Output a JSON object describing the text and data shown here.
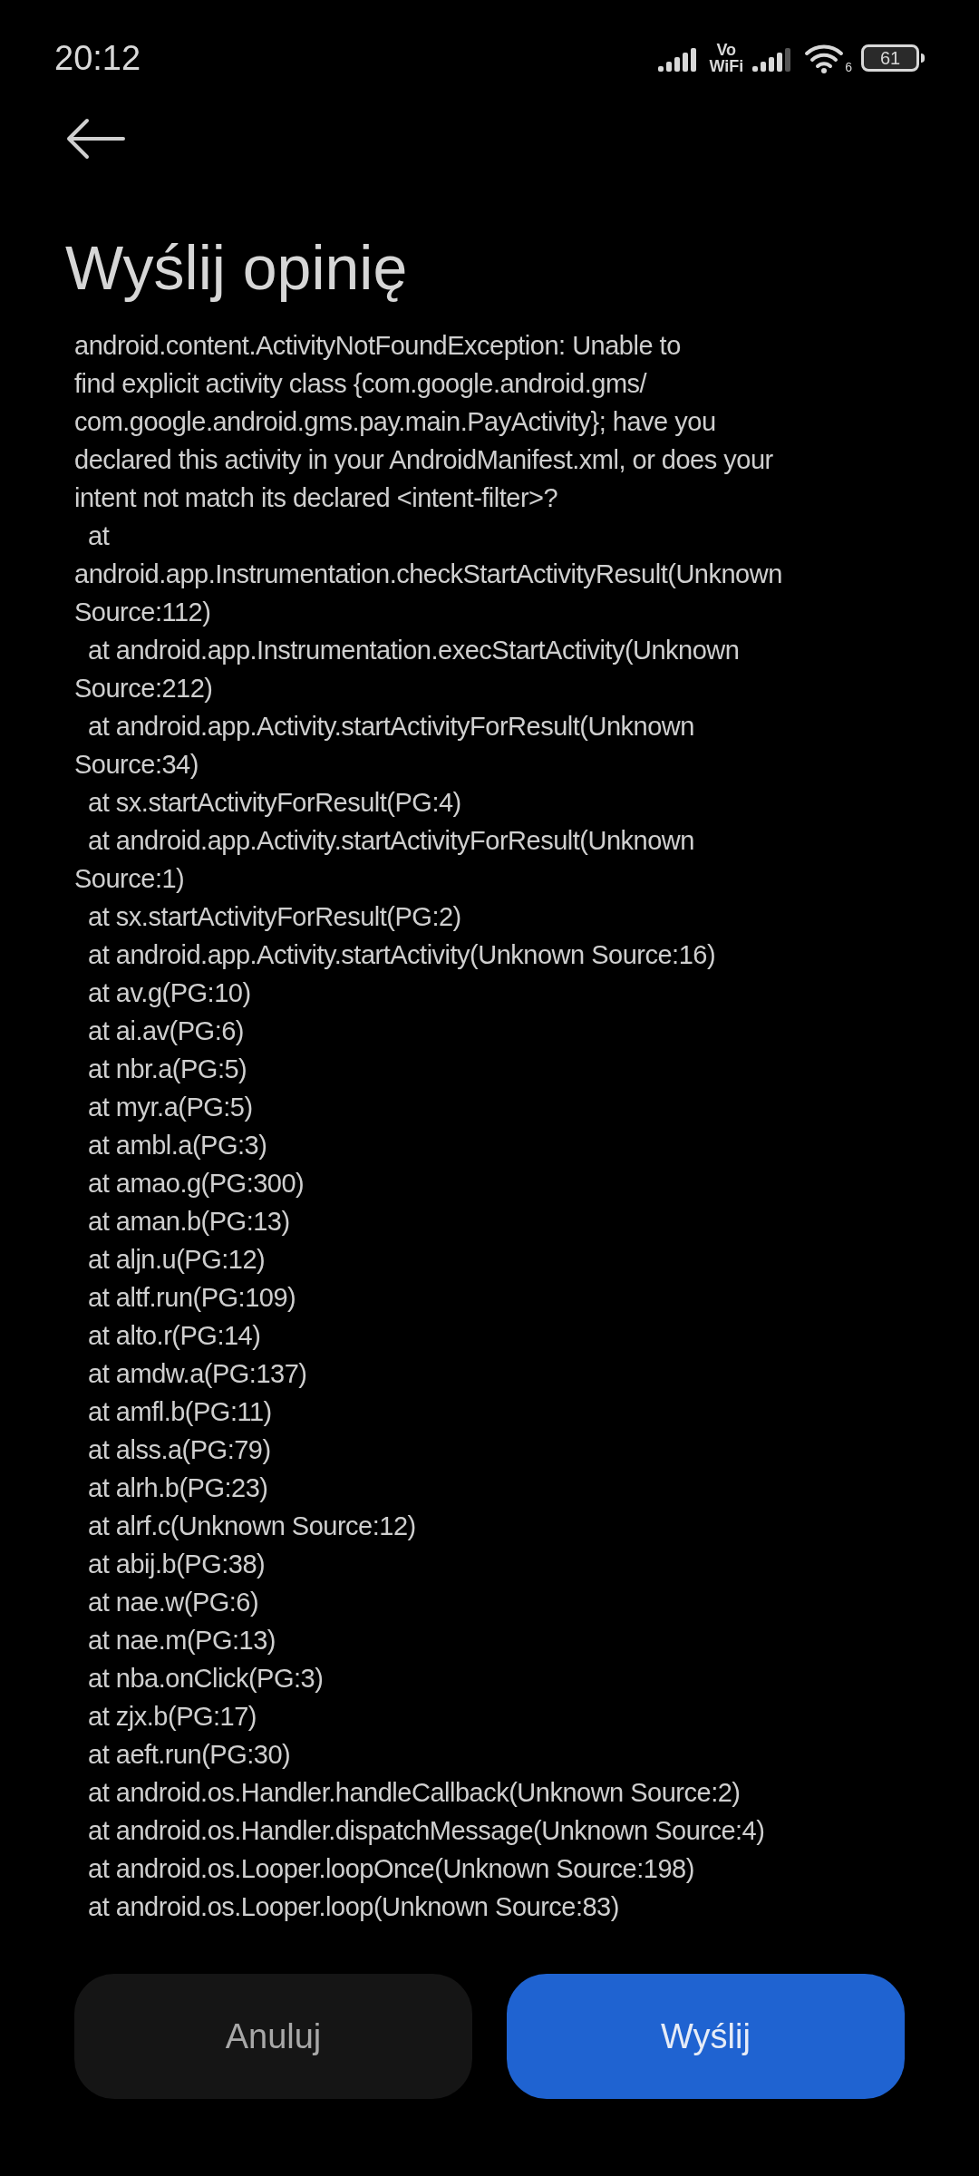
{
  "status_bar": {
    "time": "20:12",
    "vowifi_top": "Vo",
    "vowifi_bottom": "WiFi",
    "wifi_sub": "6",
    "battery": "61"
  },
  "title": "Wyślij opinię",
  "message": "android.content.ActivityNotFoundException: Unable to\nfind explicit activity class {com.google.android.gms/\ncom.google.android.gms.pay.main.PayActivity}; have you\ndeclared this activity in your AndroidManifest.xml, or does your\nintent not match its declared <intent-filter>?\n  at\nandroid.app.Instrumentation.checkStartActivityResult(Unknown\nSource:112)\n  at android.app.Instrumentation.execStartActivity(Unknown\nSource:212)\n  at android.app.Activity.startActivityForResult(Unknown\nSource:34)\n  at sx.startActivityForResult(PG:4)\n  at android.app.Activity.startActivityForResult(Unknown\nSource:1)\n  at sx.startActivityForResult(PG:2)\n  at android.app.Activity.startActivity(Unknown Source:16)\n  at av.g(PG:10)\n  at ai.av(PG:6)\n  at nbr.a(PG:5)\n  at myr.a(PG:5)\n  at ambl.a(PG:3)\n  at amao.g(PG:300)\n  at aman.b(PG:13)\n  at aljn.u(PG:12)\n  at altf.run(PG:109)\n  at alto.r(PG:14)\n  at amdw.a(PG:137)\n  at amfl.b(PG:11)\n  at alss.a(PG:79)\n  at alrh.b(PG:23)\n  at alrf.c(Unknown Source:12)\n  at abij.b(PG:38)\n  at nae.w(PG:6)\n  at nae.m(PG:13)\n  at nba.onClick(PG:3)\n  at zjx.b(PG:17)\n  at aeft.run(PG:30)\n  at android.os.Handler.handleCallback(Unknown Source:2)\n  at android.os.Handler.dispatchMessage(Unknown Source:4)\n  at android.os.Looper.loopOnce(Unknown Source:198)\n  at android.os.Looper.loop(Unknown Source:83)",
  "buttons": [
    {
      "label": "Anuluj",
      "kind": "secondary"
    },
    {
      "label": "Wyślij",
      "kind": "primary"
    }
  ]
}
